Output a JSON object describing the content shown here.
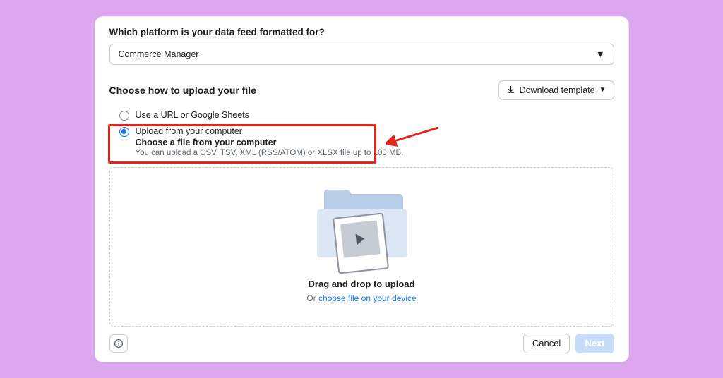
{
  "platform_question": "Which platform is your data feed formatted for?",
  "platform_selected": "Commerce Manager",
  "choose_title": "Choose how to upload your file",
  "download_template_label": "Download template",
  "option_url": "Use a URL or Google Sheets",
  "option_upload": "Upload from your computer",
  "option_upload_sub": "Choose a file from your computer",
  "option_upload_help": "You can upload a CSV, TSV, XML (RSS/ATOM) or XLSX file up to 100 MB.",
  "drop_title": "Drag and drop to upload",
  "drop_or": "Or ",
  "drop_link": "choose file on your device",
  "footer": {
    "cancel": "Cancel",
    "next": "Next"
  }
}
